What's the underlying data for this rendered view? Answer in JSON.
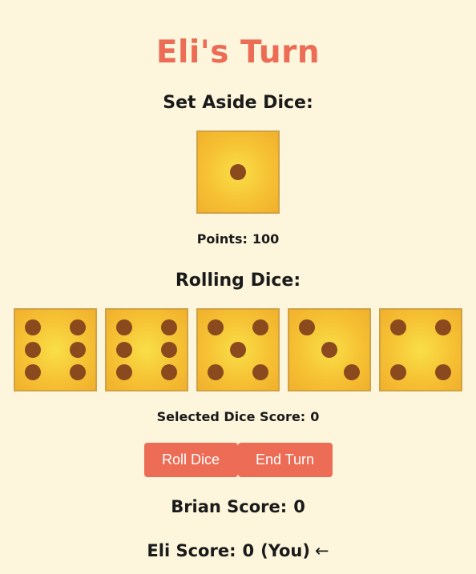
{
  "turn": {
    "title": "Eli's Turn"
  },
  "set_aside": {
    "heading": "Set Aside Dice:",
    "dice": [
      1
    ],
    "points_label": "Points:",
    "points_value": "100"
  },
  "rolling": {
    "heading": "Rolling Dice:",
    "dice": [
      6,
      6,
      5,
      3,
      4
    ],
    "selected_label": "Selected Dice Score:",
    "selected_value": "0"
  },
  "actions": {
    "roll_label": "Roll Dice",
    "end_label": "End Turn"
  },
  "scores": [
    {
      "player_label": "Brian Score:",
      "value": "0",
      "suffix": "",
      "current": false
    },
    {
      "player_label": "Eli Score:",
      "value": "0",
      "suffix": "(You)",
      "current": true,
      "indicator": "←"
    }
  ],
  "colors": {
    "background": "#fdf6dc",
    "accent": "#ec6c55",
    "die_face": "#f6c234",
    "pip": "#8a4a1e"
  }
}
